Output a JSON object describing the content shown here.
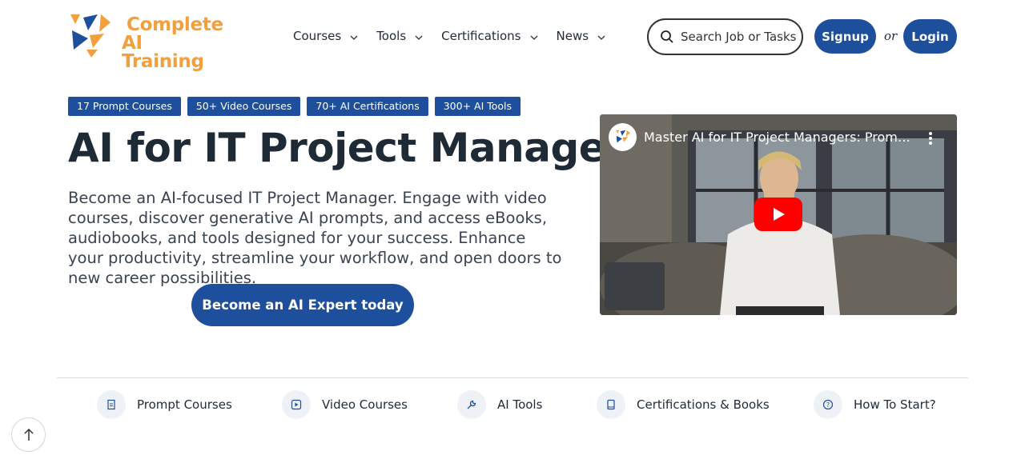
{
  "brand": {
    "line1": "Complete",
    "line2": "AI Training"
  },
  "nav": [
    {
      "label": "Courses"
    },
    {
      "label": "Tools"
    },
    {
      "label": "Certifications"
    },
    {
      "label": "News"
    }
  ],
  "search": {
    "placeholder": "Search Job or Tasks"
  },
  "auth": {
    "signup": "Signup",
    "or": "or",
    "login": "Login"
  },
  "tags": [
    "17 Prompt Courses",
    "50+ Video Courses",
    "70+ AI Certifications",
    "300+ AI Tools"
  ],
  "hero": {
    "title": "AI for IT Project Managers",
    "description": "Become an AI-focused IT Project Manager. Engage with video courses, discover generative AI prompts, and access eBooks, audiobooks, and tools designed for your success. Enhance your productivity, streamline your workflow, and open doors to new career possibilities.",
    "cta": "Become an AI Expert today"
  },
  "video": {
    "title": "Master AI for IT Project Managers: Prompt & ..."
  },
  "bottom_nav": [
    {
      "label": "Prompt Courses",
      "icon": "document-icon"
    },
    {
      "label": "Video Courses",
      "icon": "play-square-icon"
    },
    {
      "label": "AI Tools",
      "icon": "wrench-icon"
    },
    {
      "label": "Certifications & Books",
      "icon": "book-icon"
    },
    {
      "label": "How To Start?",
      "icon": "question-circle-icon"
    }
  ],
  "colors": {
    "primary": "#1e4f9c",
    "brand_orange": "#f2a03d",
    "text": "#1f2a37"
  }
}
